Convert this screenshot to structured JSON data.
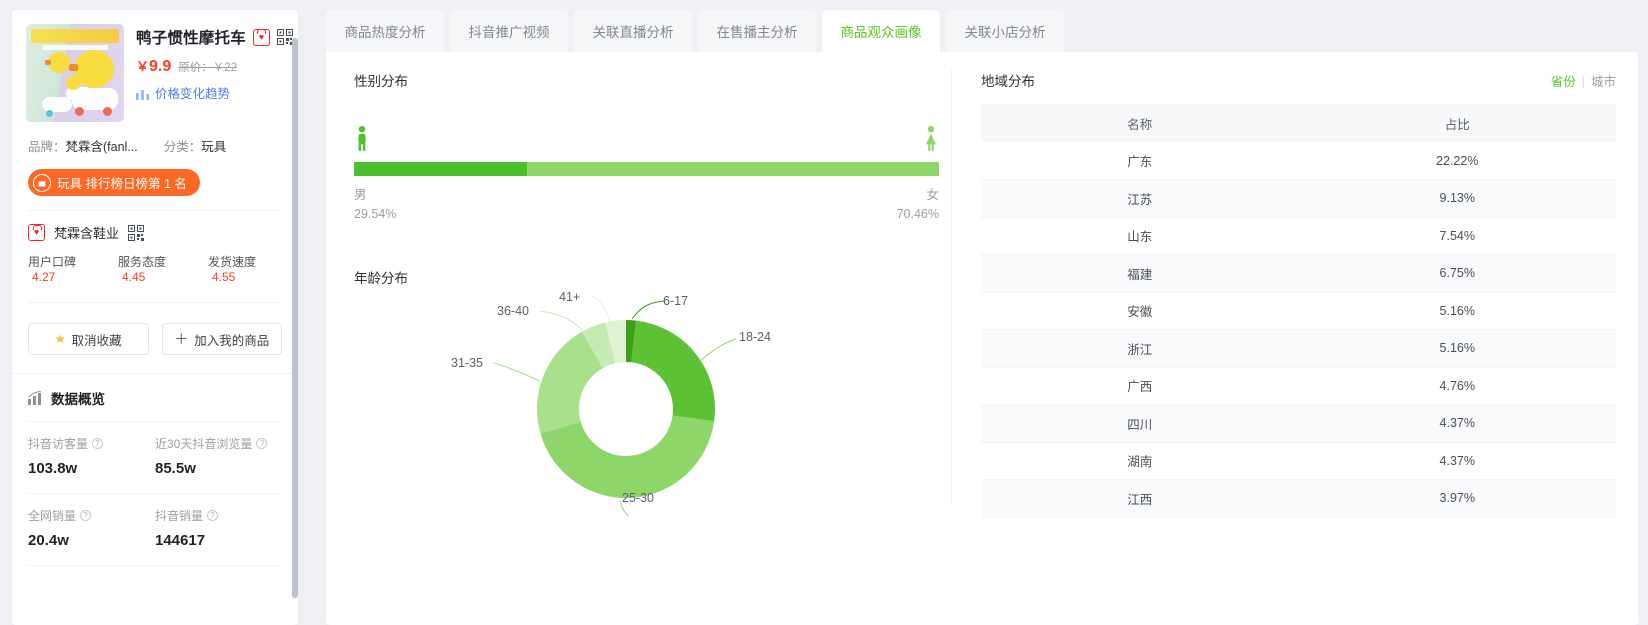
{
  "product": {
    "title": "鸭子惯性摩托车",
    "douyin_badge_icon": "douyin-shop-icon",
    "qr_icon": "qr-code-icon",
    "price": "9.9",
    "currency": "￥",
    "orig_price_label": "原价：￥22",
    "trend_link": "价格变化趋势",
    "trend_icon": "trend-chart-icon",
    "brand_label": "品牌：",
    "brand_value": "梵霖含(fanl...",
    "category_label": "分类：",
    "category_value": "玩具",
    "rank_pill": "玩具 排行榜日榜第 1 名",
    "rank_icon": "bag-icon"
  },
  "store": {
    "name": "梵霖含鞋业",
    "badge_icon": "douyin-shop-icon",
    "qr_icon": "qr-code-icon",
    "scores": [
      {
        "label": "用户口碑",
        "value": "4.27"
      },
      {
        "label": "服务态度",
        "value": "4.45"
      },
      {
        "label": "发货速度",
        "value": "4.55"
      }
    ]
  },
  "actions": {
    "unfavorite": "取消收藏",
    "unfavorite_icon": "star-icon",
    "add_product": "加入我的商品",
    "add_icon": "plus-icon"
  },
  "overview": {
    "title": "数据概览",
    "icon": "bar-chart-icon",
    "stats": [
      {
        "label": "抖音访客量",
        "value": "103.8w",
        "help_icon": "question-icon"
      },
      {
        "label": "近30天抖音浏览量",
        "value": "85.5w",
        "help_icon": "question-icon"
      },
      {
        "label": "全网销量",
        "value": "20.4w",
        "help_icon": "question-icon"
      },
      {
        "label": "抖音销量",
        "value": "144617",
        "help_icon": "question-icon"
      }
    ]
  },
  "tabs": [
    {
      "label": "商品热度分析",
      "active": false
    },
    {
      "label": "抖音推广视频",
      "active": false
    },
    {
      "label": "关联直播分析",
      "active": false
    },
    {
      "label": "在售播主分析",
      "active": false
    },
    {
      "label": "商品观众画像",
      "active": true
    },
    {
      "label": "关联小店分析",
      "active": false
    }
  ],
  "gender": {
    "title": "性别分布",
    "male_label": "男",
    "male_pct": "29.54%",
    "female_label": "女",
    "female_pct": "70.46%",
    "male_icon": "male-figure-icon",
    "female_icon": "female-figure-icon"
  },
  "age": {
    "title": "年龄分布"
  },
  "region": {
    "title": "地域分布",
    "toggle_province": "省份",
    "toggle_city": "城市",
    "columns": [
      "名称",
      "占比"
    ],
    "rows": [
      {
        "name": "广东",
        "pct": "22.22%"
      },
      {
        "name": "江苏",
        "pct": "9.13%"
      },
      {
        "name": "山东",
        "pct": "7.54%"
      },
      {
        "name": "福建",
        "pct": "6.75%"
      },
      {
        "name": "安徽",
        "pct": "5.16%"
      },
      {
        "name": "浙江",
        "pct": "5.16%"
      },
      {
        "name": "广西",
        "pct": "4.76%"
      },
      {
        "name": "四川",
        "pct": "4.37%"
      },
      {
        "name": "湖南",
        "pct": "4.37%"
      },
      {
        "name": "江西",
        "pct": "3.97%"
      }
    ]
  },
  "colors": {
    "accent_green": "#5ec12a",
    "bar_male": "#49bf2c",
    "bar_female": "#8ed66a",
    "price_red": "#fa3e1d",
    "rank_orange": "#fb6724",
    "link_blue": "#4f7fe8"
  },
  "chart_data": [
    {
      "type": "bar",
      "orientation": "horizontal-stacked",
      "title": "性别分布",
      "categories": [
        "男",
        "女"
      ],
      "values": [
        29.54,
        70.46
      ],
      "unit": "%",
      "colors": [
        "#49bf2c",
        "#8ed66a"
      ],
      "legend": "inline-ends",
      "grid": false
    },
    {
      "type": "pie",
      "variant": "donut",
      "title": "年龄分布",
      "labels": [
        "6-17",
        "18-24",
        "25-30",
        "31-35",
        "36-40",
        "41+"
      ],
      "values": [
        1.8,
        25.5,
        39.0,
        22.5,
        5.5,
        5.7
      ],
      "unit": "%",
      "colors": [
        "#3e9e18",
        "#5cc234",
        "#8ed66a",
        "#a8e08c",
        "#c7eab3",
        "#dff3d2"
      ],
      "start_angle_deg": -90,
      "inner_radius_ratio": 0.63,
      "legend": "outside-labels-with-leader-lines",
      "grid": false
    },
    {
      "type": "table",
      "title": "地域分布",
      "columns": [
        "名称",
        "占比"
      ],
      "rows": [
        [
          "广东",
          "22.22%"
        ],
        [
          "江苏",
          "9.13%"
        ],
        [
          "山东",
          "7.54%"
        ],
        [
          "福建",
          "6.75%"
        ],
        [
          "安徽",
          "5.16%"
        ],
        [
          "浙江",
          "5.16%"
        ],
        [
          "广西",
          "4.76%"
        ],
        [
          "四川",
          "4.37%"
        ],
        [
          "湖南",
          "4.37%"
        ],
        [
          "江西",
          "3.97%"
        ]
      ]
    }
  ]
}
